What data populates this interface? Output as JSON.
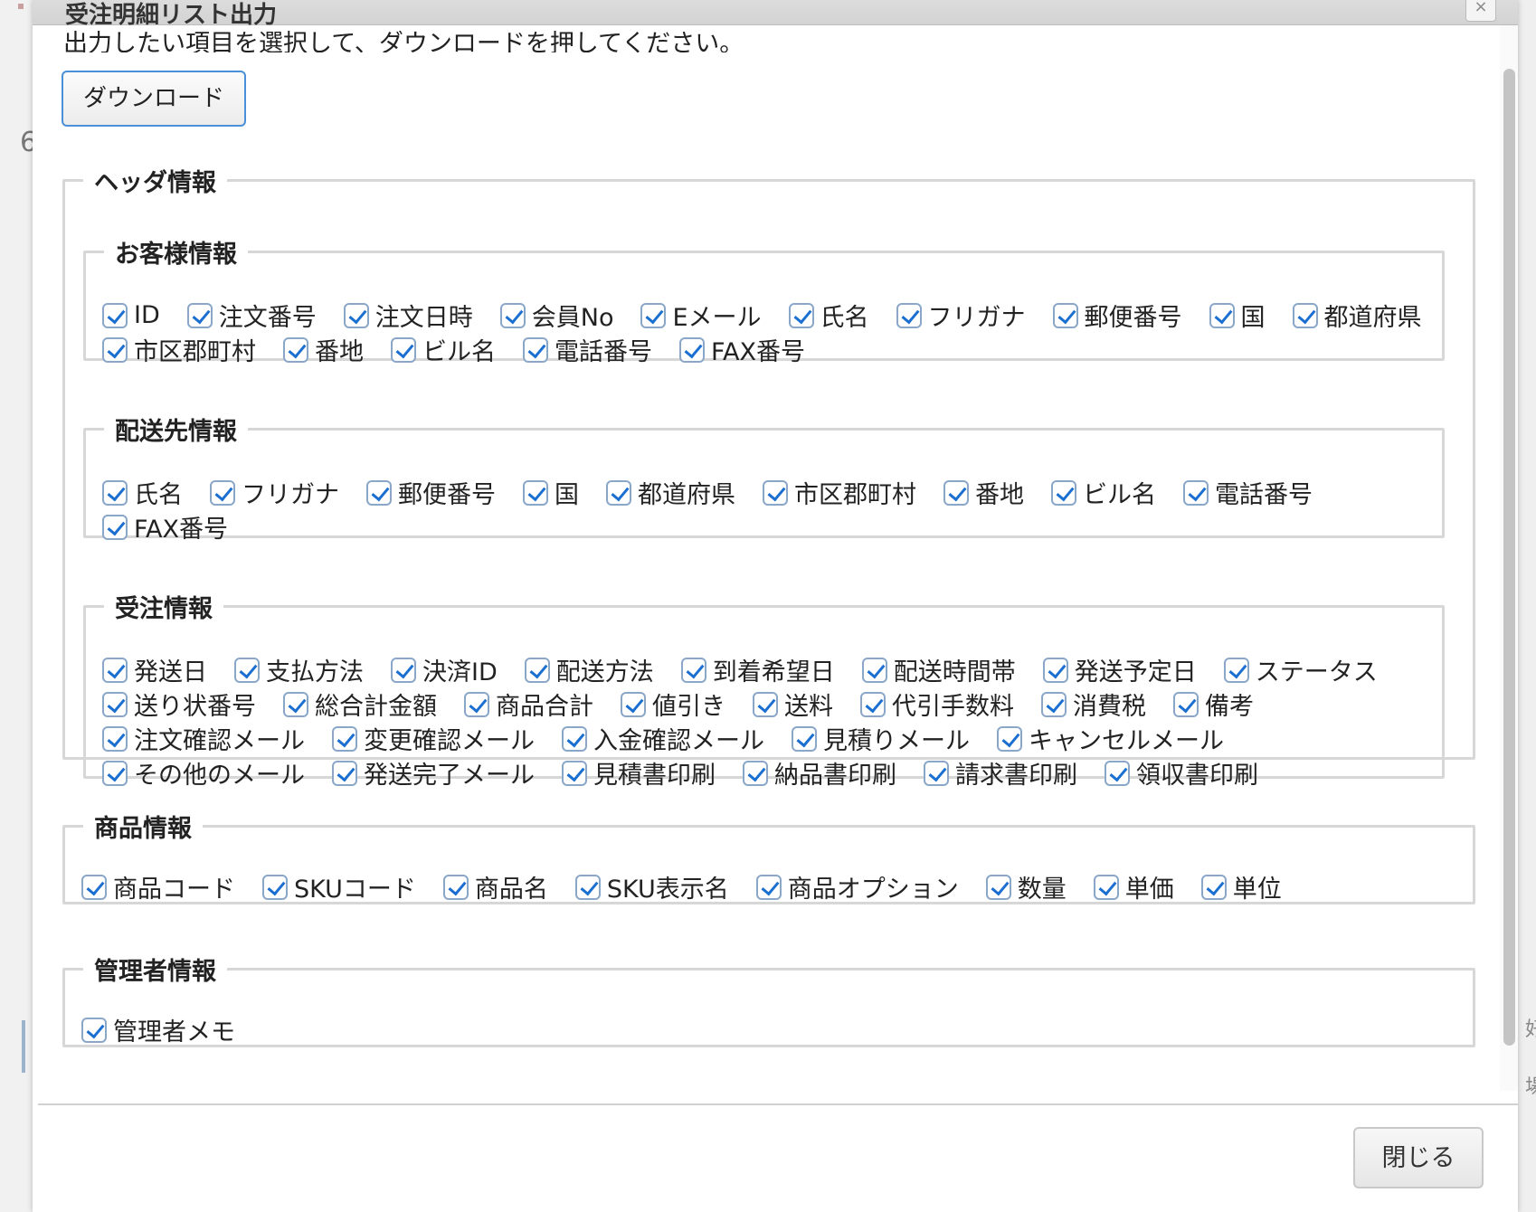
{
  "dialog": {
    "title": "受注明細リスト出力",
    "instruction": "出力したい項目を選択して、ダウンロードを押してください。",
    "download_label": "ダウンロード",
    "close_label": "閉じる",
    "close_icon": "×"
  },
  "background": {
    "left_char": "6",
    "right_chars": [
      "好",
      "場"
    ]
  },
  "header_info": {
    "legend": "ヘッダ情報",
    "customer": {
      "legend": "お客様情報",
      "items": [
        "ID",
        "注文番号",
        "注文日時",
        "会員No",
        "Eメール",
        "氏名",
        "フリガナ",
        "郵便番号",
        "国",
        "都道府県",
        "市区郡町村",
        "番地",
        "ビル名",
        "電話番号",
        "FAX番号"
      ]
    },
    "delivery": {
      "legend": "配送先情報",
      "items": [
        "氏名",
        "フリガナ",
        "郵便番号",
        "国",
        "都道府県",
        "市区郡町村",
        "番地",
        "ビル名",
        "電話番号",
        "FAX番号"
      ]
    },
    "order": {
      "legend": "受注情報",
      "items": [
        "発送日",
        "支払方法",
        "決済ID",
        "配送方法",
        "到着希望日",
        "配送時間帯",
        "発送予定日",
        "ステータス",
        "送り状番号",
        "総合計金額",
        "商品合計",
        "値引き",
        "送料",
        "代引手数料",
        "消費税",
        "備考",
        "注文確認メール",
        "変更確認メール",
        "入金確認メール",
        "見積りメール",
        "キャンセルメール",
        "その他のメール",
        "発送完了メール",
        "見積書印刷",
        "納品書印刷",
        "請求書印刷",
        "領収書印刷"
      ]
    }
  },
  "product_info": {
    "legend": "商品情報",
    "items": [
      "商品コード",
      "SKUコード",
      "商品名",
      "SKU表示名",
      "商品オプション",
      "数量",
      "単価",
      "単位"
    ]
  },
  "admin_info": {
    "legend": "管理者情報",
    "items": [
      "管理者メモ"
    ]
  },
  "checkbox_state": "checked",
  "colors": {
    "accent": "#1b6fd1",
    "border": "#d7d7d7",
    "button_focus": "#4a90d9"
  }
}
